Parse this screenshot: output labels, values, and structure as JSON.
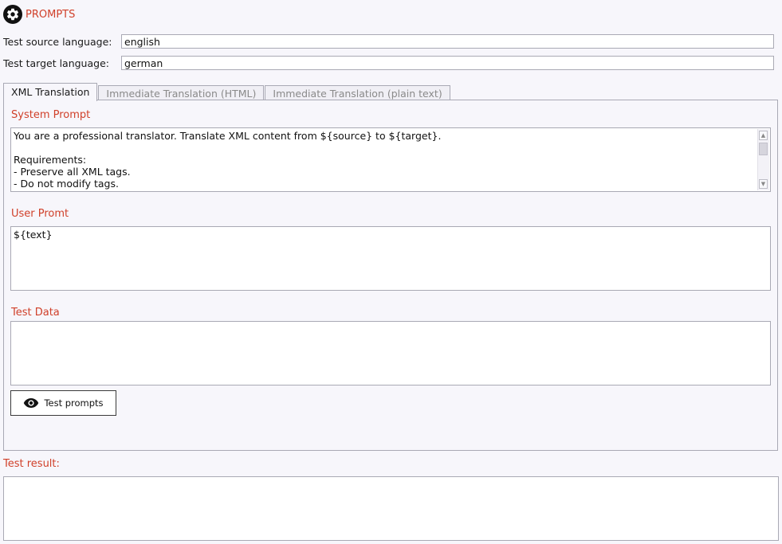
{
  "header": {
    "title": "PROMPTS",
    "icon": "gear-icon"
  },
  "fields": {
    "source_label": "Test source language:",
    "source_value": "english",
    "target_label": "Test target language:",
    "target_value": "german"
  },
  "tabs": [
    {
      "label": "XML Translation",
      "active": true
    },
    {
      "label": "Immediate Translation (HTML)",
      "active": false
    },
    {
      "label": "Immediate Translation (plain text)",
      "active": false
    }
  ],
  "system_prompt": {
    "label": "System Prompt",
    "text": "You are a professional translator. Translate XML content from ${source} to ${target}.\n\nRequirements:\n- Preserve all XML tags.\n- Do not modify tags."
  },
  "user_prompt": {
    "label": "User Promt",
    "text": "${text}"
  },
  "test_data": {
    "label": "Test Data",
    "text": ""
  },
  "test_button": {
    "label": "Test prompts",
    "icon": "eye-icon"
  },
  "result": {
    "label": "Test result:",
    "text": ""
  },
  "colors": {
    "accent": "#d0402a",
    "border": "#a9a9b4",
    "background": "#f7f6fb"
  }
}
